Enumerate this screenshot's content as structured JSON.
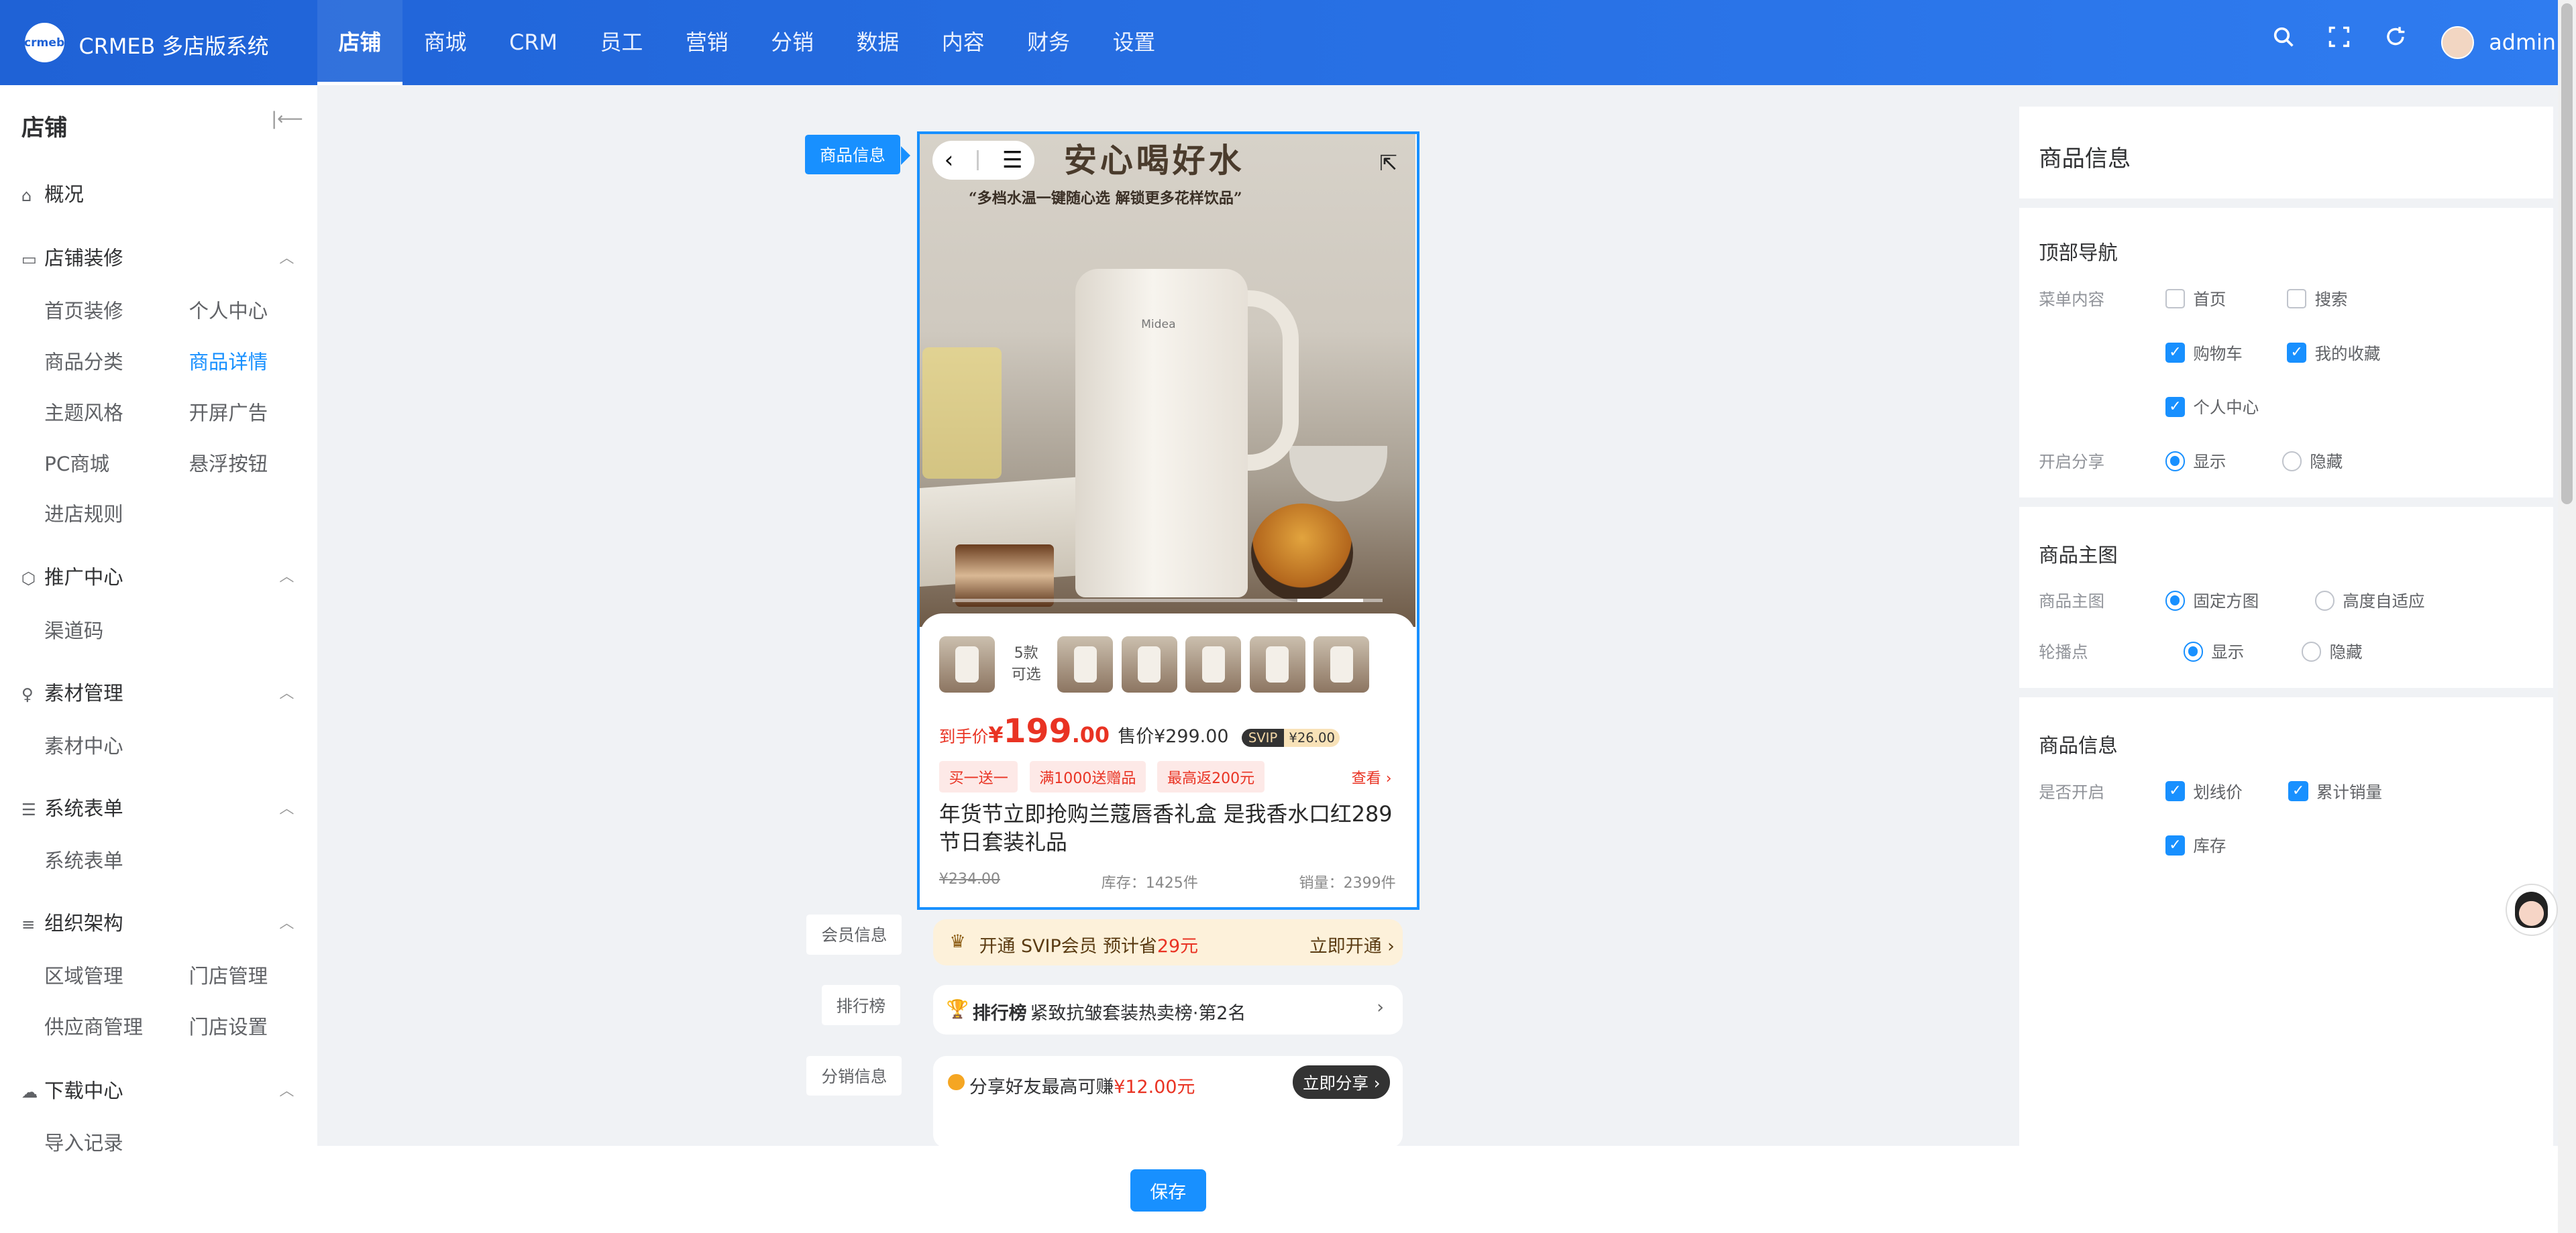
{
  "app": {
    "logo_text": "crmeb",
    "name": "CRMEB 多店版系统"
  },
  "topnav": [
    "店铺",
    "商城",
    "CRM",
    "员工",
    "营销",
    "分销",
    "数据",
    "内容",
    "财务",
    "设置"
  ],
  "user": {
    "name": "admin"
  },
  "sidebar": {
    "title": "店铺",
    "overview": "概况",
    "groups": {
      "decor": {
        "label": "店铺装修",
        "items": [
          "首页装修",
          "个人中心",
          "商品分类",
          "商品详情",
          "主题风格",
          "开屏广告",
          "PC商城",
          "悬浮按钮",
          "进店规则"
        ]
      },
      "promo": {
        "label": "推广中心",
        "items": [
          "渠道码"
        ]
      },
      "material": {
        "label": "素材管理",
        "items": [
          "素材中心"
        ]
      },
      "forms": {
        "label": "系统表单",
        "items": [
          "系统表单"
        ]
      },
      "org": {
        "label": "组织架构",
        "items": [
          "区域管理",
          "门店管理",
          "供应商管理",
          "门店设置"
        ]
      },
      "download": {
        "label": "下载中心",
        "items": [
          "导入记录"
        ]
      }
    }
  },
  "preview": {
    "section_tags": {
      "product_info": "商品信息",
      "member_info": "会员信息",
      "ranking": "排行榜",
      "distribution": "分销信息"
    },
    "banner": {
      "title": "安心喝好水",
      "subtitle": "“多档水温一键随心选 解锁更多花样饮品”",
      "brand": "Midea"
    },
    "styles_count": "5款",
    "styles_label": "可选",
    "price": {
      "label": "到手价",
      "currency": "¥",
      "integer": "199",
      "decimal": ".00",
      "original": "售价¥299.00",
      "svip_tag": "SVIP",
      "svip_price": "¥26.00"
    },
    "coupons": [
      "买一送一",
      "满1000送赠品",
      "最高返200元"
    ],
    "see_more": "查看",
    "product_title": "年货节立即抢购兰蔻唇香礼盒 是我香水口红289节日套装礼品",
    "strike_price": "¥234.00",
    "stock": "库存：1425件",
    "sales": "销量：2399件",
    "svip_bar": {
      "text": "开通 SVIP会员 预计省",
      "amount": "29元",
      "action": "立即开通"
    },
    "rank_bar": {
      "badge": "排行榜",
      "text": "紧致抗皱套装热卖榜·第2名"
    },
    "dist_bar": {
      "text": "分享好友最高可赚",
      "amount": "¥12.00元",
      "action": "立即分享"
    }
  },
  "save_label": "保存",
  "panel": {
    "title": "商品信息",
    "top_nav": {
      "heading": "顶部导航",
      "menu_label": "菜单内容",
      "options": [
        {
          "label": "首页",
          "checked": false
        },
        {
          "label": "搜索",
          "checked": false
        },
        {
          "label": "购物车",
          "checked": true
        },
        {
          "label": "我的收藏",
          "checked": true
        },
        {
          "label": "个人中心",
          "checked": true
        }
      ],
      "share_label": "开启分享",
      "share_options": [
        {
          "label": "显示",
          "selected": true
        },
        {
          "label": "隐藏",
          "selected": false
        }
      ]
    },
    "main_image": {
      "heading": "商品主图",
      "image_label": "商品主图",
      "image_options": [
        {
          "label": "固定方图",
          "selected": true
        },
        {
          "label": "高度自适应",
          "selected": false
        }
      ],
      "dots_label": "轮播点",
      "dots_options": [
        {
          "label": "显示",
          "selected": true
        },
        {
          "label": "隐藏",
          "selected": false
        }
      ]
    },
    "product_info": {
      "heading": "商品信息",
      "enable_label": "是否开启",
      "options": [
        {
          "label": "划线价",
          "checked": true
        },
        {
          "label": "累计销量",
          "checked": true
        },
        {
          "label": "库存",
          "checked": true
        }
      ]
    }
  },
  "colors": {
    "primary": "#1890ff",
    "price": "#e93323",
    "header": "#2f7cf0"
  }
}
